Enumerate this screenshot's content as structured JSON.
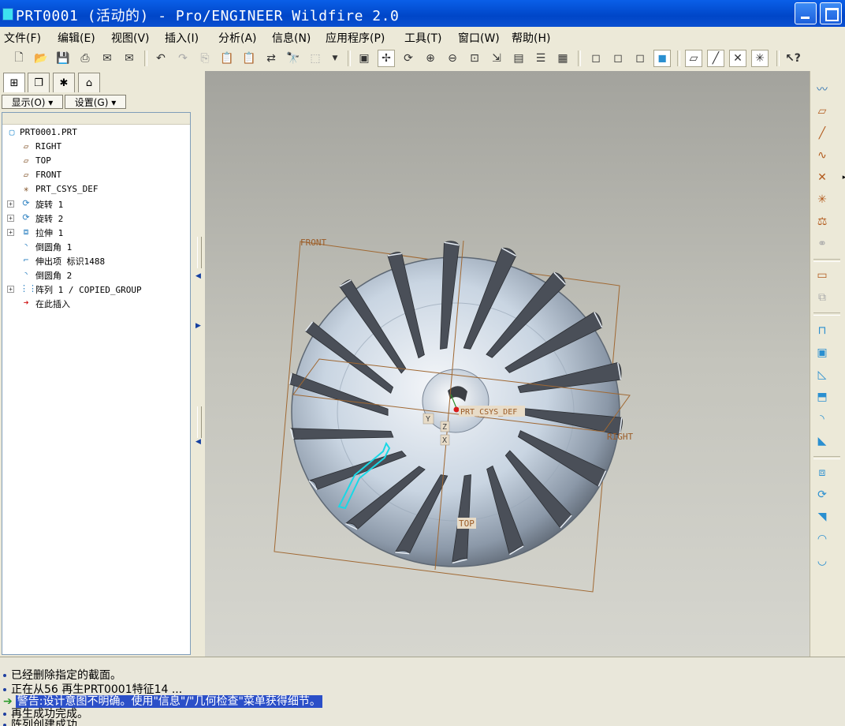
{
  "window": {
    "title": "PRT0001 (活动的) - Pro/ENGINEER Wildfire 2.0"
  },
  "menu": [
    "文件(F)",
    "编辑(E)",
    "视图(V)",
    "插入(I)",
    "分析(A)",
    "信息(N)",
    "应用程序(P)",
    "工具(T)",
    "窗口(W)",
    "帮助(H)"
  ],
  "panel": {
    "tab_icons": [
      "model-tree-tab-icon",
      "layer-tree-tab-icon",
      "favorites-tab-icon",
      "connections-tab-icon"
    ],
    "show_btn": "显示(O) ▾",
    "settings_btn": "设置(G) ▾"
  },
  "tree": [
    {
      "label": "PRT0001.PRT",
      "icon": "part-icon",
      "expand": false,
      "indent": 0
    },
    {
      "label": "RIGHT",
      "icon": "datum-plane-icon",
      "expand": false,
      "indent": 1
    },
    {
      "label": "TOP",
      "icon": "datum-plane-icon",
      "expand": false,
      "indent": 1
    },
    {
      "label": "FRONT",
      "icon": "datum-plane-icon",
      "expand": false,
      "indent": 1
    },
    {
      "label": "PRT_CSYS_DEF",
      "icon": "csys-icon",
      "expand": false,
      "indent": 1
    },
    {
      "label": "旋转 1",
      "icon": "revolve-icon",
      "expand": true,
      "indent": 1
    },
    {
      "label": "旋转 2",
      "icon": "revolve-icon",
      "expand": true,
      "indent": 1
    },
    {
      "label": "拉伸 1",
      "icon": "extrude-icon",
      "expand": true,
      "indent": 1
    },
    {
      "label": "倒圆角 1",
      "icon": "round-icon",
      "expand": false,
      "indent": 1
    },
    {
      "label": "伸出项 标识1488",
      "icon": "protrusion-icon",
      "expand": false,
      "indent": 1
    },
    {
      "label": "倒圆角 2",
      "icon": "round-icon",
      "expand": false,
      "indent": 1
    },
    {
      "label": "阵列 1 / COPIED_GROUP",
      "icon": "pattern-icon",
      "expand": true,
      "indent": 1
    },
    {
      "label": "在此插入",
      "icon": "insert-arrow-icon",
      "expand": false,
      "indent": 1
    }
  ],
  "viewport": {
    "datum_labels": {
      "front": "FRONT",
      "right": "RIGHT",
      "top": "TOP",
      "csys": "PRT_CSYS_DEF"
    },
    "axis_labels": [
      "Y",
      "Z",
      "X"
    ],
    "blade_count": 18
  },
  "messages": [
    {
      "text": "已经删除指定的截面。",
      "highlight": false
    },
    {
      "text": "正在从56 再生PRT0001特征14 ...",
      "highlight": false
    },
    {
      "text": "警告:设计意图不明确。使用\"信息\"/\"几何检查\"菜单获得细节。",
      "highlight": true
    },
    {
      "text": "再生成功完成。",
      "highlight": false
    },
    {
      "text": "阵列创建成功",
      "highlight": false
    }
  ],
  "colors": {
    "titlebar": "#0a5fe8",
    "highlight": "#2b4fc8",
    "datum": "#b06a2c",
    "blade": "#4a4f58",
    "selected": "#18d8e6"
  }
}
